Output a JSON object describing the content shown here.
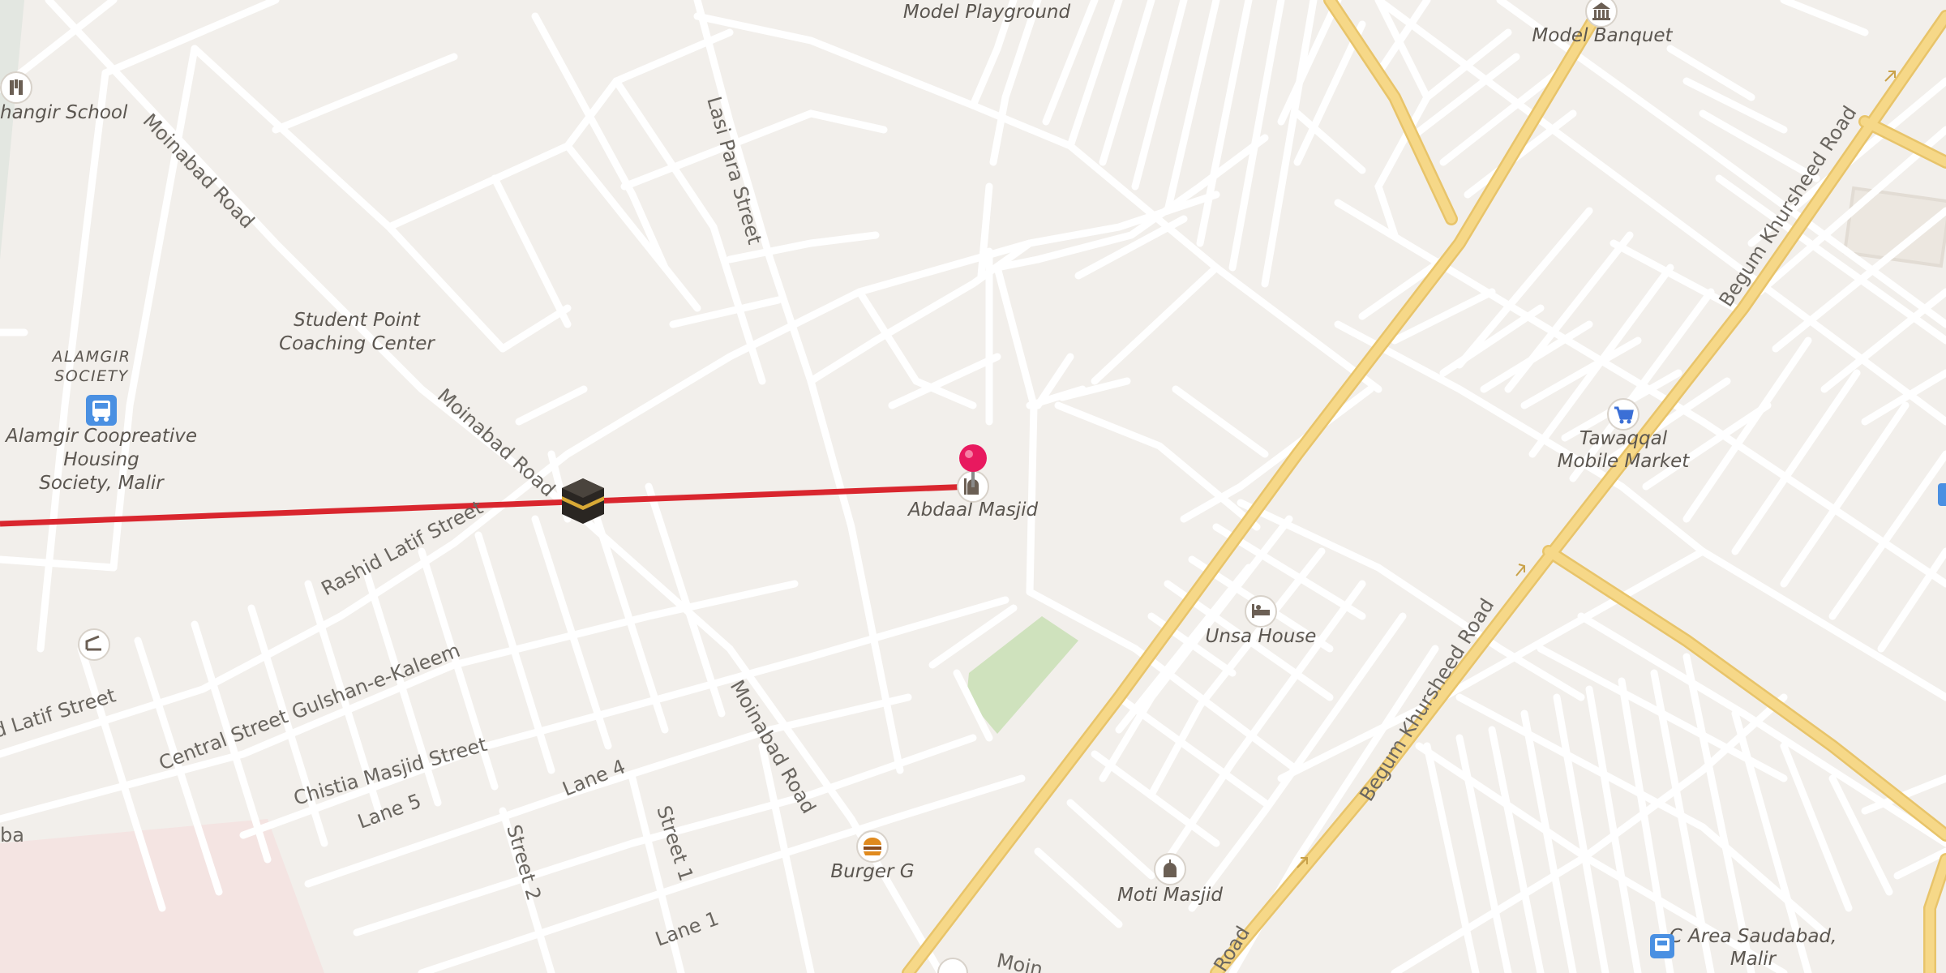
{
  "map": {
    "accent_route_color": "#d9262e",
    "pin_color": "#e8195f",
    "major_road_color": "#f4cf72",
    "background_color": "#f2efeb"
  },
  "streets": {
    "moinabad_1": "Moinabad Road",
    "moinabad_2": "Moinabad Road",
    "moinabad_3": "Moinabad Road",
    "moinabad_4": "Moin",
    "lasi_para": "Lasi Para Street",
    "rashid_latif": "Rashid Latif Street",
    "rashid_latif_2": "d Latif Street",
    "central_street": "Central Street Gulshan-e-Kaleem",
    "chistia": "Chistia Masjid Street",
    "lane5": "Lane 5",
    "lane4": "Lane 4",
    "lane1": "Lane 1",
    "street2": "Street 2",
    "street1": "Street 1",
    "begum_1": "Begum Khursheed Road",
    "begum_2": "Begum Khursheed Road",
    "begum_3": "Road",
    "edge_ba": "ba"
  },
  "places": {
    "model_playground": "Model Playground",
    "model_banquet": "Model Banquet",
    "school": "hangir School",
    "student_point_1": "Student Point",
    "student_point_2": "Coaching Center",
    "alamgir_society_1": "ALAMGIR",
    "alamgir_society_2": "SOCIETY",
    "alamgir_coop_1": "Alamgir Coopreative",
    "alamgir_coop_2": "Housing",
    "alamgir_coop_3": "Society, Malir",
    "abdaal_masjid": "Abdaal Masjid",
    "unsa_house": "Unsa House",
    "tawaqqal_1": "Tawaqqal",
    "tawaqqal_2": "Mobile Market",
    "burger_g": "Burger G",
    "moti_masjid": "Moti Masjid",
    "c_area_1": "C Area Saudabad,",
    "c_area_2": "Malir"
  },
  "icons": {
    "school": "school-icon",
    "bank": "bank-icon",
    "bus": "bus-stop-icon",
    "mosque": "mosque-icon",
    "hotel": "hotel-icon",
    "shop": "shopping-cart-icon",
    "food": "burger-icon",
    "kaaba": "kaaba-icon",
    "pin": "map-pin-icon"
  }
}
